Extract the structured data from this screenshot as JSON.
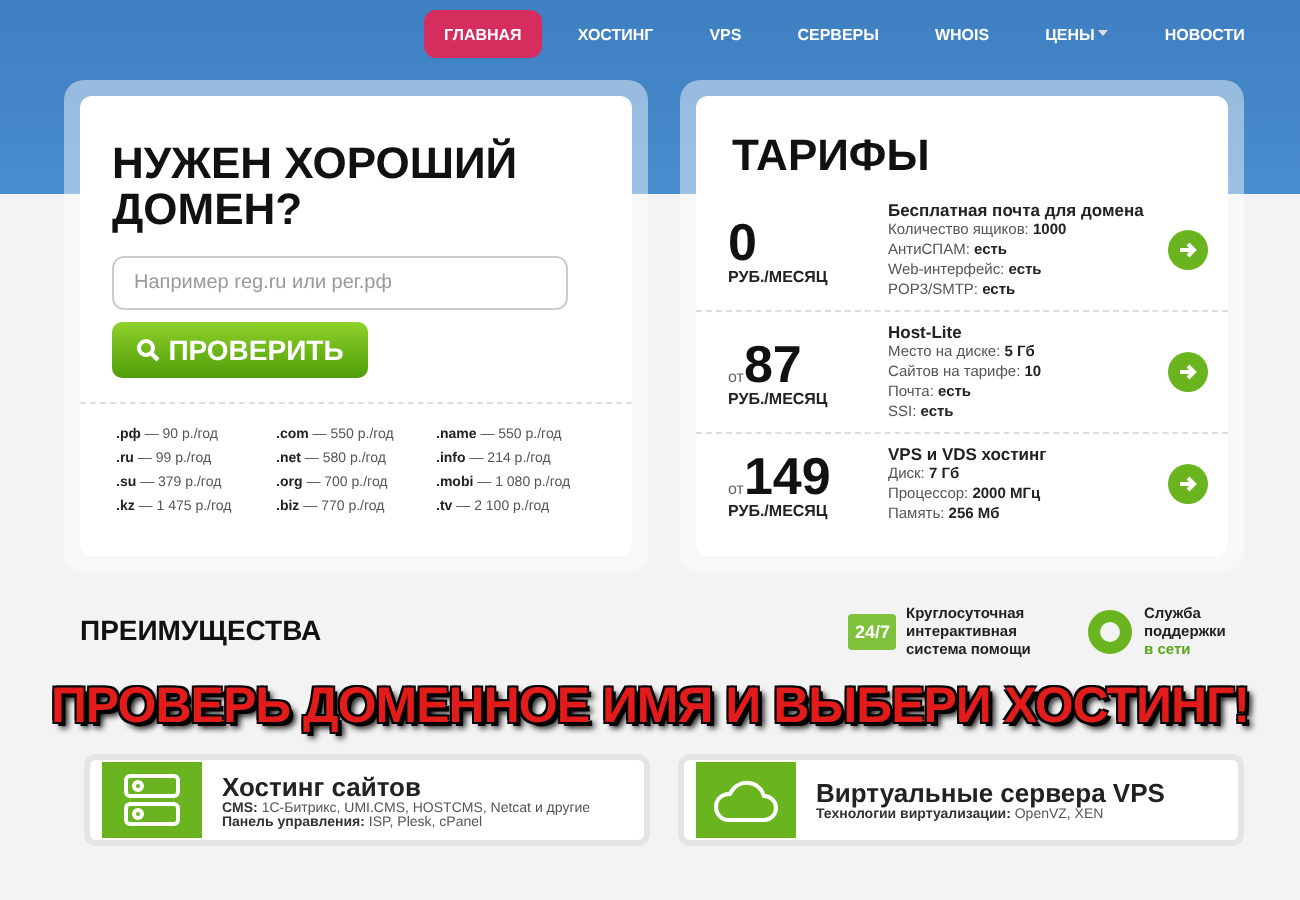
{
  "nav": [
    {
      "label": "ГЛАВНАЯ",
      "selected": true,
      "dropdown": false
    },
    {
      "label": "ХОСТИНГ",
      "selected": false,
      "dropdown": false
    },
    {
      "label": "VPS",
      "selected": false,
      "dropdown": false
    },
    {
      "label": "СЕРВЕРЫ",
      "selected": false,
      "dropdown": false
    },
    {
      "label": "WHOIS",
      "selected": false,
      "dropdown": false
    },
    {
      "label": "ЦЕНЫ",
      "selected": false,
      "dropdown": true
    },
    {
      "label": "НОВОСТИ",
      "selected": false,
      "dropdown": false
    }
  ],
  "domain_card": {
    "title": "НУЖЕН ХОРОШИЙ ДОМЕН?",
    "placeholder": "Например reg.ru или рег.рф",
    "button": "ПРОВЕРИТЬ",
    "zones": [
      {
        "zone": ".рф",
        "price": "— 90 р./год"
      },
      {
        "zone": ".ru",
        "price": "— 99 р./год"
      },
      {
        "zone": ".su",
        "price": "— 379 р./год"
      },
      {
        "zone": ".kz",
        "price": "— 1 475 р./год"
      },
      {
        "zone": ".com",
        "price": "— 550 р./год"
      },
      {
        "zone": ".net",
        "price": "— 580 р./год"
      },
      {
        "zone": ".org",
        "price": "— 700 р./год"
      },
      {
        "zone": ".biz",
        "price": "— 770 р./год"
      },
      {
        "zone": ".name",
        "price": "— 550 р./год"
      },
      {
        "zone": ".info",
        "price": "— 214 р./год"
      },
      {
        "zone": ".mobi",
        "price": "— 1 080 р./год"
      },
      {
        "zone": ".tv",
        "price": "— 2 100 р./год"
      }
    ]
  },
  "tariffs": {
    "title": "ТАРИФЫ",
    "plans": [
      {
        "price": "0",
        "unit": "РУБ./МЕСЯЦ",
        "name": "Бесплатная почта для домена",
        "lines": [
          "Количество ящиков: **1000**",
          "АнтиСПАМ: **есть**",
          "Web-интерфейс: **есть**",
          "POP3/SMTP: **есть**"
        ]
      },
      {
        "prefix": "от",
        "price": "87",
        "unit": "РУБ./МЕСЯЦ",
        "name": "Host-Lite",
        "lines": [
          "Место на диске: **5 Гб**",
          "Сайтов на тарифе: **10**",
          "Почта: **есть**",
          "SSI: **есть**"
        ]
      },
      {
        "prefix": "от",
        "price": "149",
        "unit": "РУБ./МЕСЯЦ",
        "name": "VPS и VDS хостинг",
        "lines": [
          "Диск: **7 Гб**",
          "Процессор: **2000 МГц**",
          "Память: **256 Мб**"
        ]
      }
    ]
  },
  "advantages": {
    "title": "ПРЕИМУЩЕСТВА",
    "badge_247": {
      "icon_text": "24/7",
      "text": "Круглосуточная интерактивная система помощи"
    },
    "support": {
      "text": "Служба поддержки",
      "status": "в сети"
    }
  },
  "banner": "ПРОВЕРЬ ДОМЕННОЕ ИМЯ И ВЫБЕРИ ХОСТИНГ!",
  "services": [
    {
      "kind": "server",
      "title": "Хостинг сайтов",
      "lines": [
        "**CMS:** 1С-Битрикс, UMI.CMS, HOSTCMS, Netcat и другие",
        "**Панель управления:** ISP, Plesk, cPanel"
      ]
    },
    {
      "kind": "cloud",
      "title": "Виртуальные сервера VPS",
      "lines": [
        "**Технологии виртуализации:** OpenVZ, XEN"
      ]
    }
  ]
}
